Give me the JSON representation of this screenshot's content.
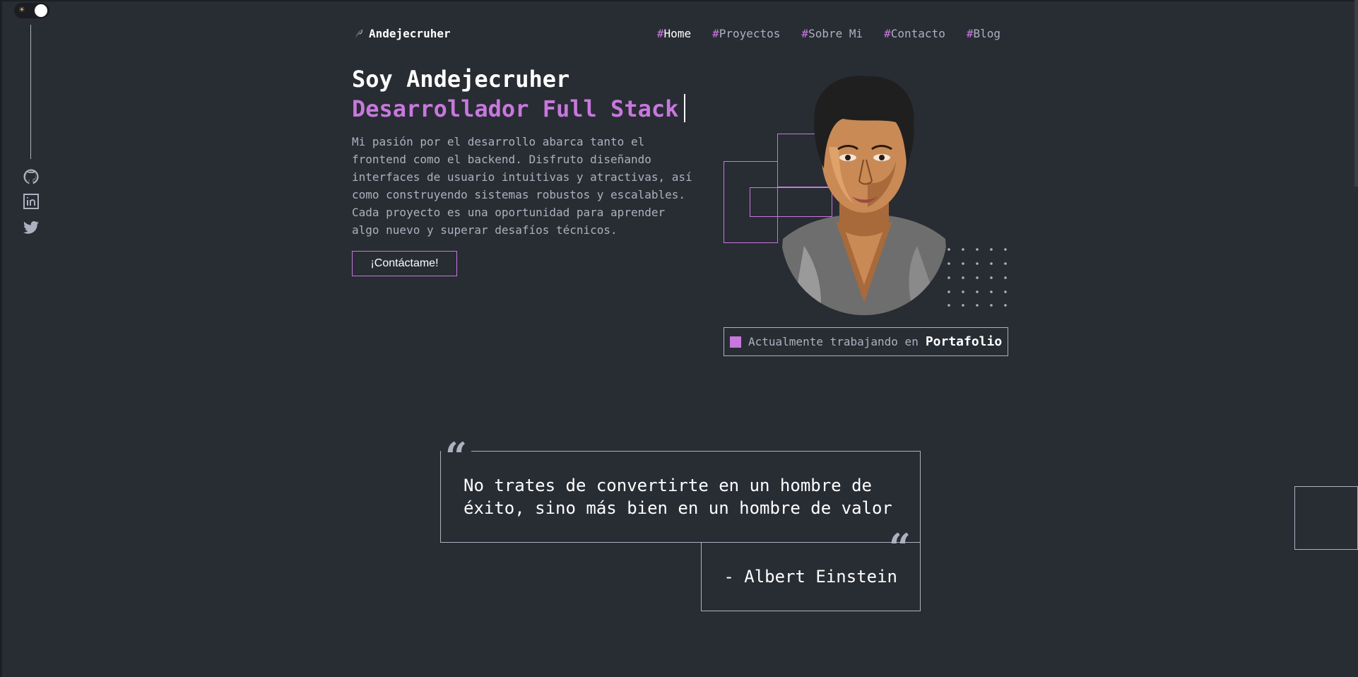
{
  "brand": {
    "name": "Andejecruher"
  },
  "nav": [
    {
      "hash": "#",
      "label": "Home",
      "active": true
    },
    {
      "hash": "#",
      "label": "Proyectos"
    },
    {
      "hash": "#",
      "label": "Sobre Mi"
    },
    {
      "hash": "#",
      "label": "Contacto"
    },
    {
      "hash": "#",
      "label": "Blog"
    }
  ],
  "theme_toggle": {
    "icon": "sun-icon",
    "state": "dark"
  },
  "social": [
    {
      "icon": "github-icon"
    },
    {
      "icon": "linkedin-icon"
    },
    {
      "icon": "twitter-icon"
    }
  ],
  "hero": {
    "greeting": "Soy Andejecruher",
    "role": "Desarrollador Full Stack",
    "description": "Mi pasión por el desarrollo abarca tanto el frontend como el backend. Disfruto diseñando interfaces de usuario intuitivas y atractivas, así como construyendo sistemas robustos y escalables. Cada proyecto es una oportunidad para aprender algo nuevo y superar desafíos técnicos.",
    "cta": "¡Contáctame!"
  },
  "status": {
    "prefix": "Actualmente trabajando en",
    "project": "Portafolio"
  },
  "quote": {
    "text": "No trates de convertirte en un hombre de éxito, sino más bien en un hombre de valor",
    "author": "- Albert Einstein",
    "open_mark": "“",
    "close_mark": "“"
  },
  "colors": {
    "bg": "#282c33",
    "accent": "#c778dd",
    "text": "#abb2bf",
    "white": "#ffffff"
  }
}
